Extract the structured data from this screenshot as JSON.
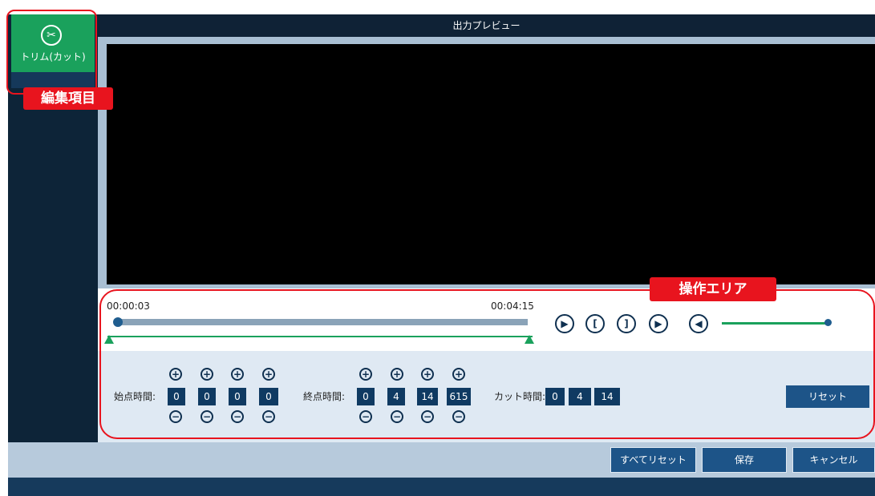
{
  "window": {
    "title": "出力プレビュー"
  },
  "sidebar": {
    "trim_tab": {
      "icon": "scissors-icon",
      "label": "トリム(カット)"
    }
  },
  "timeline": {
    "start_time": "00:00:03",
    "end_time": "00:04:15",
    "position_fraction": 0.0
  },
  "controls": {
    "icons": [
      "play-icon",
      "set-start-bracket-icon",
      "set-end-bracket-icon",
      "play-selection-icon",
      "volume-icon"
    ],
    "glyphs": {
      "play": "▶",
      "mark_in": "[",
      "mark_out": "]",
      "play_range": "▶",
      "volume": "◀"
    },
    "volume_fraction": 0.96
  },
  "trim": {
    "start_label": "始点時間:",
    "start_values": [
      "0",
      "0",
      "0",
      "0"
    ],
    "end_label": "終点時間:",
    "end_values": [
      "0",
      "4",
      "14",
      "615"
    ],
    "cut_label": "カット時間:",
    "cut_values": [
      "0",
      "4",
      "14"
    ],
    "plus": "+",
    "minus": "−",
    "reset_label": "リセット"
  },
  "footer": {
    "reset_all_label": "すべてリセット",
    "save_label": "保存",
    "cancel_label": "キャンセル"
  },
  "annotations": {
    "edit_items_label": "編集項目",
    "operation_area_label": "操作エリア",
    "color": "#e8141e"
  }
}
